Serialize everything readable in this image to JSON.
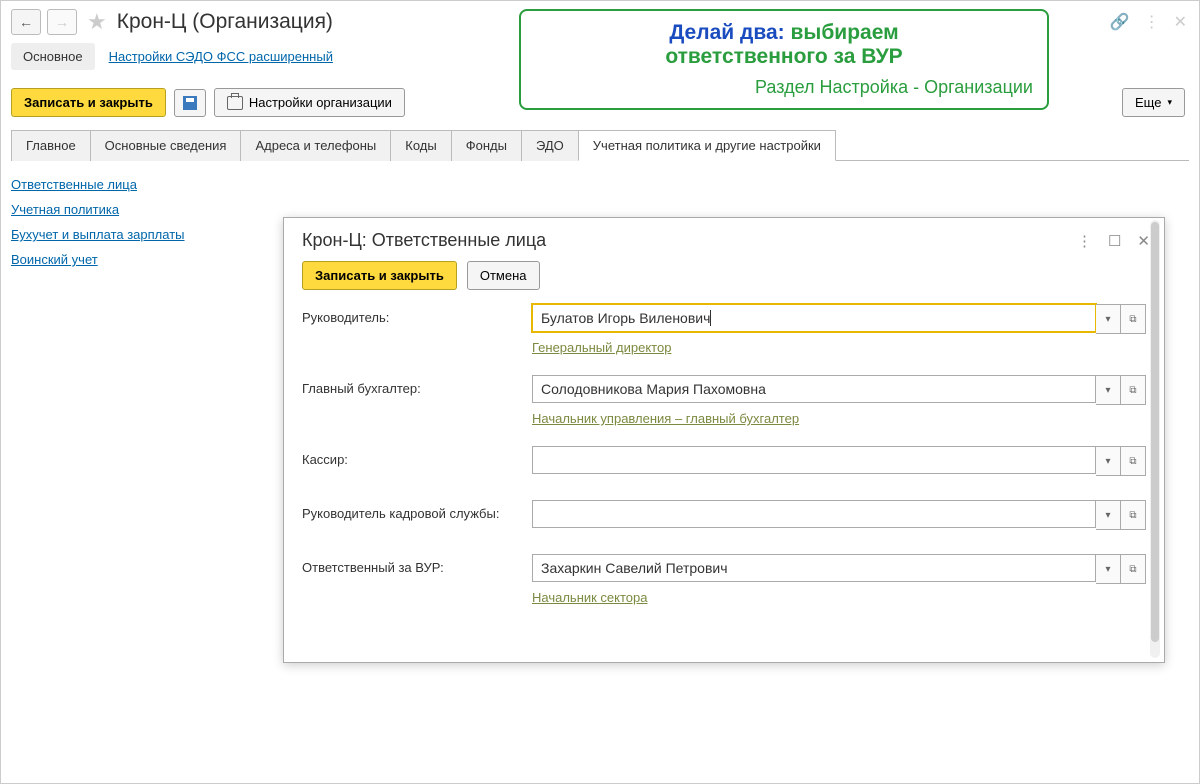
{
  "title": "Крон-Ц (Организация)",
  "subhead": {
    "tab": "Основное",
    "link": "Настройки СЭДО ФСС расширенный"
  },
  "callout": {
    "l1a": "Делай два:",
    "l1b": "выбираем",
    "l2": "ответственного за ВУР",
    "l3": "Раздел Настройка - Организации"
  },
  "toolbar": {
    "save_close": "Записать и закрыть",
    "settings": "Настройки организации",
    "more": "Еще"
  },
  "tabs": [
    "Главное",
    "Основные сведения",
    "Адреса и телефоны",
    "Коды",
    "Фонды",
    "ЭДО",
    "Учетная политика и другие настройки"
  ],
  "active_tab": 6,
  "sidelinks": [
    "Ответственные лица",
    "Учетная политика",
    "Бухучет и выплата зарплаты",
    "Воинский учет"
  ],
  "dialog": {
    "title": "Крон-Ц: Ответственные лица",
    "save_close": "Записать и закрыть",
    "cancel": "Отмена",
    "rows": [
      {
        "label": "Руководитель:",
        "value": "Булатов Игорь Виленович",
        "sub": "Генеральный директор",
        "focus": true
      },
      {
        "label": "Главный бухгалтер:",
        "value": "Солодовникова Мария Пахомовна",
        "sub": "Начальник управления – главный бухгалтер"
      },
      {
        "label": "Кассир:",
        "value": "",
        "sub": ""
      },
      {
        "label": "Руководитель кадровой службы:",
        "value": "",
        "sub": ""
      },
      {
        "label": "Ответственный за ВУР:",
        "value": "Захаркин Савелий Петрович",
        "sub": "Начальник сектора"
      }
    ]
  }
}
